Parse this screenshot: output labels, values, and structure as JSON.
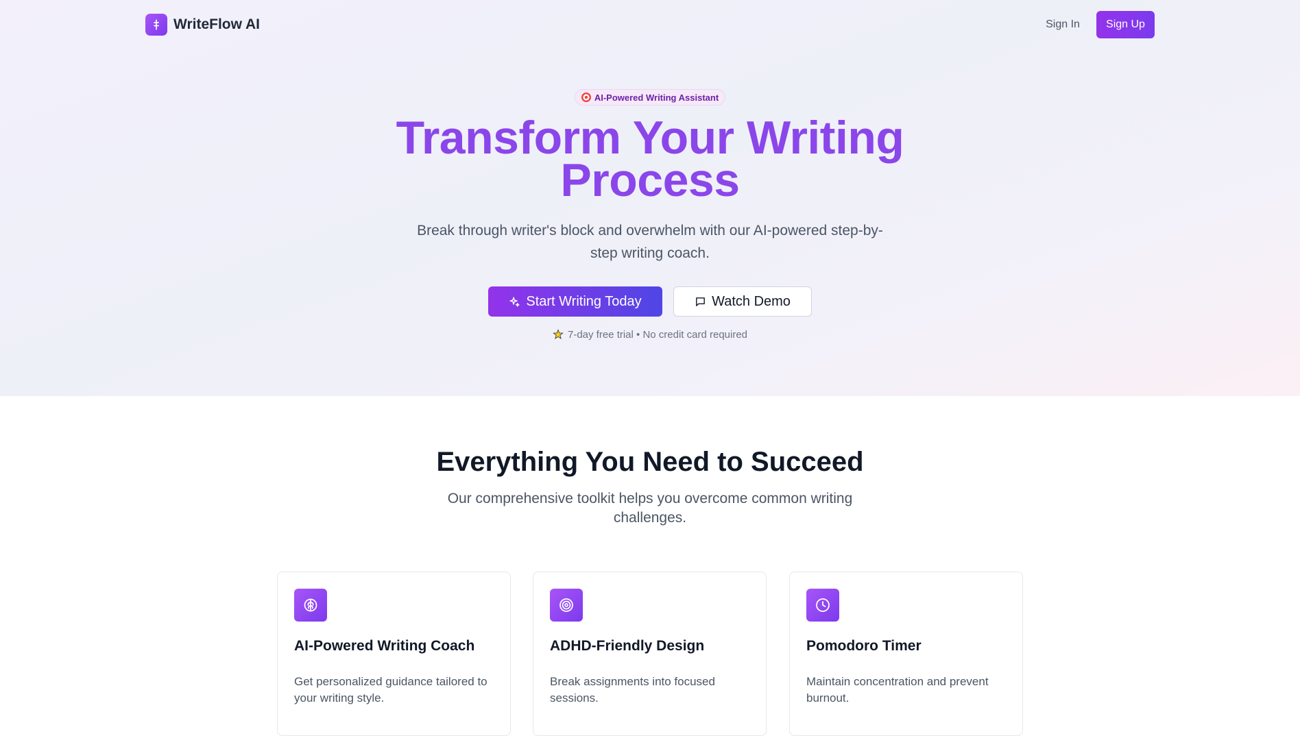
{
  "nav": {
    "brand": "WriteFlow AI",
    "sign_in": "Sign In",
    "sign_up": "Sign Up"
  },
  "hero": {
    "badge": "AI-Powered Writing Assistant",
    "title": "Transform Your Writing Process",
    "subtitle": "Break through writer's block and overwhelm with our AI-powered step-by-step writing coach.",
    "primary_cta": "Start Writing Today",
    "secondary_cta": "Watch Demo",
    "trial_note": "7-day free trial • No credit card required"
  },
  "features": {
    "title": "Everything You Need to Succeed",
    "subtitle": "Our comprehensive toolkit helps you overcome common writing challenges.",
    "cards": [
      {
        "icon": "brain-icon",
        "title": "AI-Powered Writing Coach",
        "description": "Get personalized guidance tailored to your writing style."
      },
      {
        "icon": "target-icon",
        "title": "ADHD-Friendly Design",
        "description": "Break assignments into focused sessions."
      },
      {
        "icon": "clock-icon",
        "title": "Pomodoro Timer",
        "description": "Maintain concentration and prevent burnout."
      }
    ]
  },
  "colors": {
    "accent": "#8b46ea",
    "button_gradient_start": "#9333ea",
    "button_gradient_end": "#4f46e5"
  }
}
